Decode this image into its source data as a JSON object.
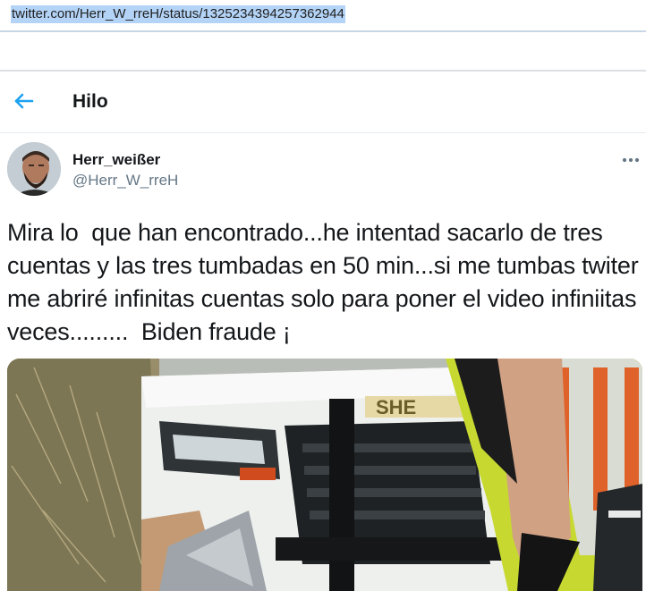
{
  "browser": {
    "url": "twitter.com/Herr_W_rreH/status/1325234394257362944"
  },
  "header": {
    "back_icon": "arrow-left-icon",
    "title": "Hilo"
  },
  "tweet": {
    "author_name": "Herr_weißer",
    "author_handle": "@Herr_W_rreH",
    "more_icon": "more-horizontal-icon",
    "text": "Mira lo  que han encontrado...he intentad sacarlo de tres cuentas y las tres tumbadas en 50 min...si me tumbas twiter me abriré infinitas cuentas solo para poner el video infiniitas veces.........  Biden fraude ¡",
    "media_vehicle_label": "SHE"
  },
  "colors": {
    "accent": "#1da1f2",
    "handle_gray": "#657786",
    "url_highlight": "#b4d4f7"
  }
}
